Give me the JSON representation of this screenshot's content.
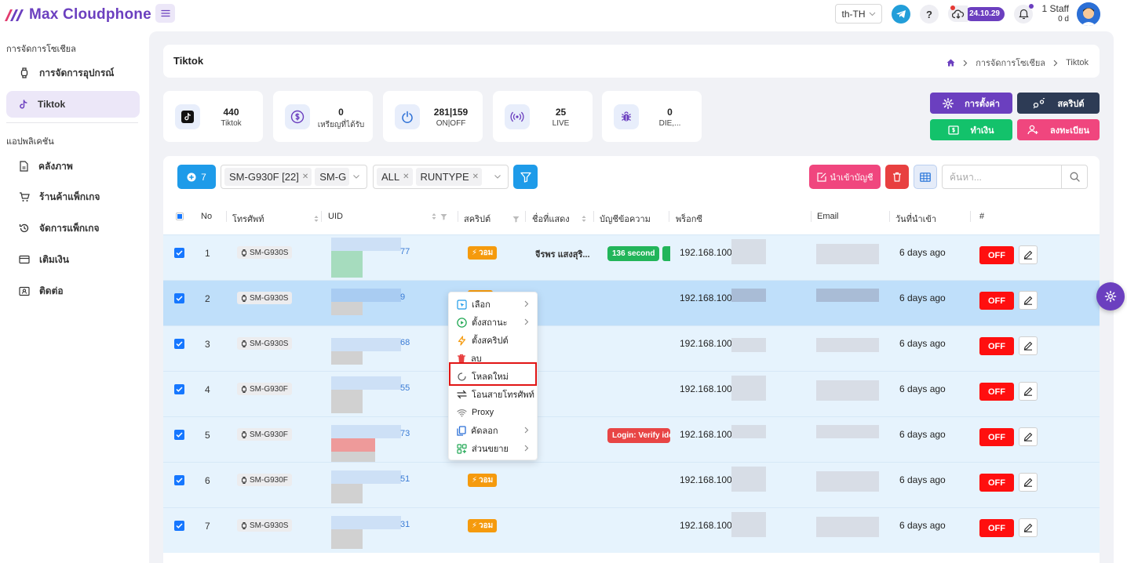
{
  "app": {
    "name": "Max Cloudphone"
  },
  "topbar": {
    "language": "th-TH",
    "help": "?",
    "version": "24.10.29",
    "staff_name": "1 Staff",
    "staff_sub": "0 d"
  },
  "sidebar": {
    "section1": "การจัดการโซเชียล",
    "items1": [
      {
        "label": "การจัดการอุปกรณ์",
        "icon": "watch-icon"
      },
      {
        "label": "Tiktok",
        "icon": "tiktok-icon",
        "active": true
      }
    ],
    "section2": "แอปพลิเคชัน",
    "items2": [
      {
        "label": "คลังภาพ",
        "icon": "file-icon"
      },
      {
        "label": "ร้านค้าแพ็กเกจ",
        "icon": "cart-icon"
      },
      {
        "label": "จัดการแพ็กเกจ",
        "icon": "history-icon"
      },
      {
        "label": "เติมเงิน",
        "icon": "card-icon"
      },
      {
        "label": "ติดต่อ",
        "icon": "contact-icon"
      }
    ]
  },
  "header": {
    "title": "Tiktok",
    "breadcrumb": [
      "การจัดการโซเชียล",
      "Tiktok"
    ]
  },
  "stats": [
    {
      "value": "440",
      "label": "Tiktok"
    },
    {
      "value": "0",
      "label": "เหรียญที่ได้รับ"
    },
    {
      "value": "281|159",
      "label": "ON|OFF"
    },
    {
      "value": "25",
      "label": "LIVE"
    },
    {
      "value": "0",
      "label": "DIE,..."
    }
  ],
  "actions": {
    "settings": "การตั้งค่า",
    "script": "สคริปต์",
    "earn": "ทำเงิน",
    "register": "ลงทะเบียน"
  },
  "toolbar": {
    "count": "7",
    "device_tags": [
      "SM-G930F [22]",
      "SM-G"
    ],
    "type_tags": [
      "ALL",
      "RUNTYPE"
    ],
    "import_label": "นำเข้าบัญชี",
    "search_placeholder": "ค้นหา..."
  },
  "columns": [
    "No",
    "โทรศัพท์",
    "UID",
    "สคริปต์",
    "ชื่อที่แสดง",
    "บัญชีข้อความ",
    "พร็อกซี",
    "Email",
    "วันที่นำเข้า",
    "#"
  ],
  "rows": [
    {
      "no": "1",
      "device": "SM-G930S",
      "uid_tail": "77",
      "script": "วอม",
      "display": "จีรพร แสงสุริ...",
      "note": "136 second",
      "note_color": "#22b55a",
      "proxy": "192.168.100.2",
      "date": "6 days ago",
      "status": "OFF"
    },
    {
      "no": "2",
      "device": "SM-G930S",
      "uid_tail": "9",
      "script": "",
      "display": "",
      "note": "",
      "note_color": "",
      "proxy": "192.168.100.2",
      "date": "6 days ago",
      "status": "OFF"
    },
    {
      "no": "3",
      "device": "SM-G930S",
      "uid_tail": "68",
      "script": "",
      "display": "",
      "note": "",
      "note_color": "",
      "proxy": "192.168.100.2",
      "date": "6 days ago",
      "status": "OFF"
    },
    {
      "no": "4",
      "device": "SM-G930F",
      "uid_tail": "55",
      "script": "",
      "display": "",
      "note": "",
      "note_color": "",
      "proxy": "192.168.100.2",
      "date": "6 days ago",
      "status": "OFF"
    },
    {
      "no": "5",
      "device": "SM-G930F",
      "uid_tail": "73",
      "script": "",
      "display": "",
      "note": "Login: Verify iden",
      "note_color": "#e84545",
      "proxy": "192.168.100.2",
      "date": "6 days ago",
      "status": "OFF"
    },
    {
      "no": "6",
      "device": "SM-G930F",
      "uid_tail": "51",
      "script": "วอม",
      "display": "",
      "note": "",
      "note_color": "",
      "proxy": "192.168.100.2",
      "date": "6 days ago",
      "status": "OFF"
    },
    {
      "no": "7",
      "device": "SM-G930S",
      "uid_tail": "31",
      "script": "วอม",
      "display": "",
      "note": "",
      "note_color": "",
      "proxy": "192.168.100.2",
      "date": "6 days ago",
      "status": "OFF"
    }
  ],
  "context_menu": [
    {
      "label": "เลือก",
      "icon": "select-icon",
      "submenu": true
    },
    {
      "label": "ตั้งสถานะ",
      "icon": "play-circle-icon",
      "submenu": true
    },
    {
      "label": "ตั้งสคริปต์",
      "icon": "lightning-icon",
      "submenu": false
    },
    {
      "label": "ลบ",
      "icon": "trash-icon",
      "submenu": false
    },
    {
      "label": "โหลดใหม่",
      "icon": "reload-icon",
      "submenu": false
    },
    {
      "label": "โอนสายโทรศัพท์",
      "icon": "transfer-icon",
      "submenu": false
    },
    {
      "label": "Proxy",
      "icon": "wifi-icon",
      "submenu": false
    },
    {
      "label": "คัดลอก",
      "icon": "copy-icon",
      "submenu": true
    },
    {
      "label": "ส่วนขยาย",
      "icon": "extension-icon",
      "submenu": true
    }
  ],
  "colors": {
    "brand": "#6b3fbf",
    "primary": "#1e9be9",
    "danger": "#ff0f0f",
    "pink": "#f0467e",
    "green": "#22b55a",
    "orange": "#f59a0d"
  }
}
